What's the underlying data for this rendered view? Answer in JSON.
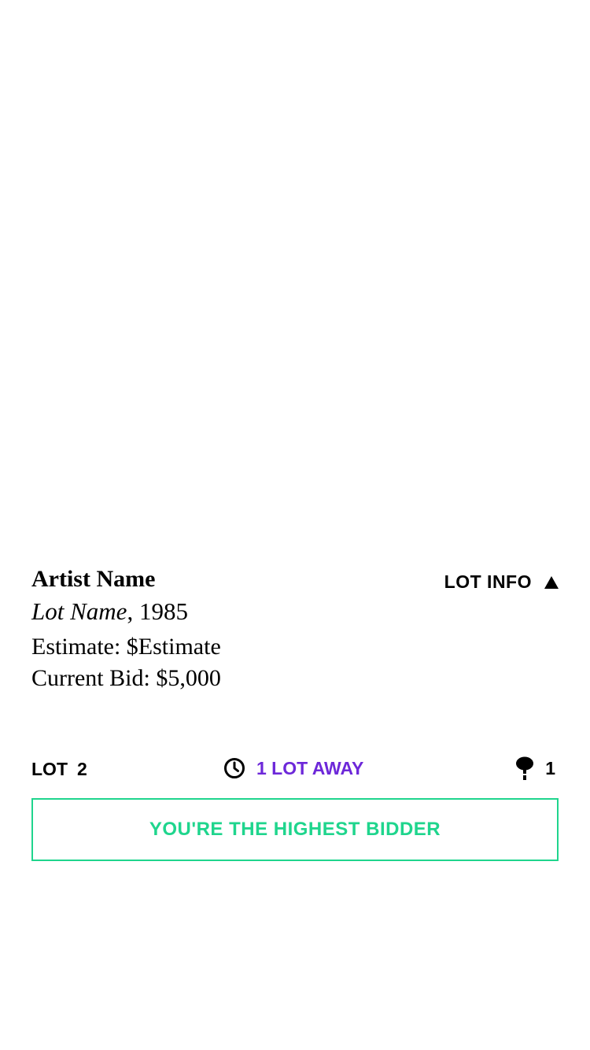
{
  "lot": {
    "artist_name": "Artist Name",
    "lot_name": "Lot Name",
    "year_suffix": ", 1985",
    "estimate": "Estimate: $Estimate",
    "current_bid": "Current Bid: $5,000",
    "lot_info_label": "LOT INFO",
    "lot_info_icon": "triangle-up-icon"
  },
  "status": {
    "lot_label": "LOT",
    "lot_number": "2",
    "lots_away": "1 LOT AWAY",
    "lots_away_icon": "clock-icon",
    "bid_count": "1",
    "bid_icon": "bid-paddle-icon"
  },
  "banner": {
    "text": "YOU'RE THE HIGHEST BIDDER"
  },
  "colors": {
    "accent_purple": "#6d28d9",
    "accent_green": "#1fd58d",
    "text": "#000000",
    "background": "#ffffff"
  }
}
